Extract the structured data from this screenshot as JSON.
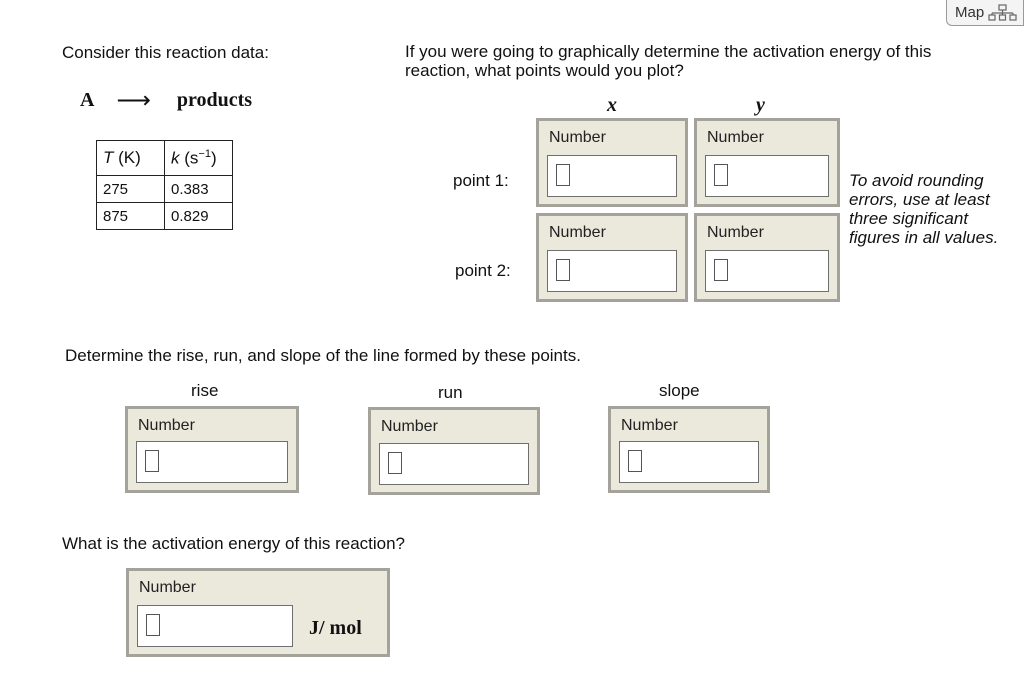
{
  "map_button": {
    "label": "Map"
  },
  "left": {
    "intro": "Consider this reaction data:",
    "reaction": {
      "reactant": "A",
      "arrow": "⟶",
      "product": "products"
    },
    "table": {
      "col1_var": "T",
      "col1_unit": " (K)",
      "col2_var": "k",
      "col2_unit": " (s",
      "col2_exp": "−1",
      "col2_close": ")",
      "rows": [
        [
          "275",
          "0.383"
        ],
        [
          "875",
          "0.829"
        ]
      ]
    }
  },
  "question1": {
    "text": "If you were going to graphically determine the activation energy of this reaction, what points would you plot?",
    "x_header": "x",
    "y_header": "y",
    "point1_label": "point 1:",
    "point2_label": "point 2:",
    "field_label": "Number",
    "hint": "To avoid rounding errors, use at least three significant figures in all values."
  },
  "question2": {
    "text": "Determine the rise, run, and slope of the line formed by these points.",
    "rise_label": "rise",
    "run_label": "run",
    "slope_label": "slope"
  },
  "question3": {
    "text": "What is the activation energy of this reaction?",
    "unit": "J/ mol"
  }
}
